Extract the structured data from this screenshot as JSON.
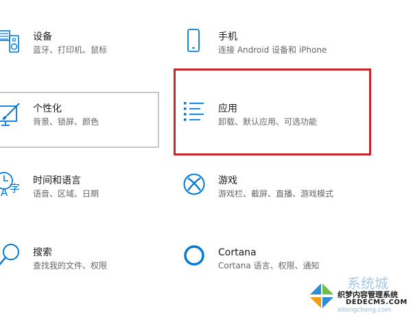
{
  "accent_color": "#0078d7",
  "tiles": {
    "devices": {
      "title": "设备",
      "desc": "蓝牙、打印机、鼠标",
      "icon": "keyboard-speaker-icon"
    },
    "phone": {
      "title": "手机",
      "desc": "连接 Android 设备和 iPhone",
      "icon": "phone-icon"
    },
    "personalization": {
      "title": "个性化",
      "desc": "背景、锁屏、颜色",
      "icon": "paint-brush-monitor-icon"
    },
    "apps": {
      "title": "应用",
      "desc": "卸载、默认应用、可选功能",
      "icon": "app-list-icon"
    },
    "time_language": {
      "title": "时间和语言",
      "desc": "语音、区域、日期",
      "icon": "time-language-icon"
    },
    "gaming": {
      "title": "游戏",
      "desc": "游戏栏、截屏、直播、游戏模式",
      "icon": "xbox-icon"
    },
    "search": {
      "title": "搜索",
      "desc": "查找我的文件、权限",
      "icon": "search-icon"
    },
    "cortana": {
      "title": "Cortana",
      "desc": "Cortana 语言、权限、通知",
      "icon": "cortana-ring-icon"
    }
  },
  "watermark": {
    "brand": "系统城",
    "line1": "织梦内容管理系统",
    "line2": "DEDECMS.COM",
    "url": "xitongcheng.com"
  }
}
